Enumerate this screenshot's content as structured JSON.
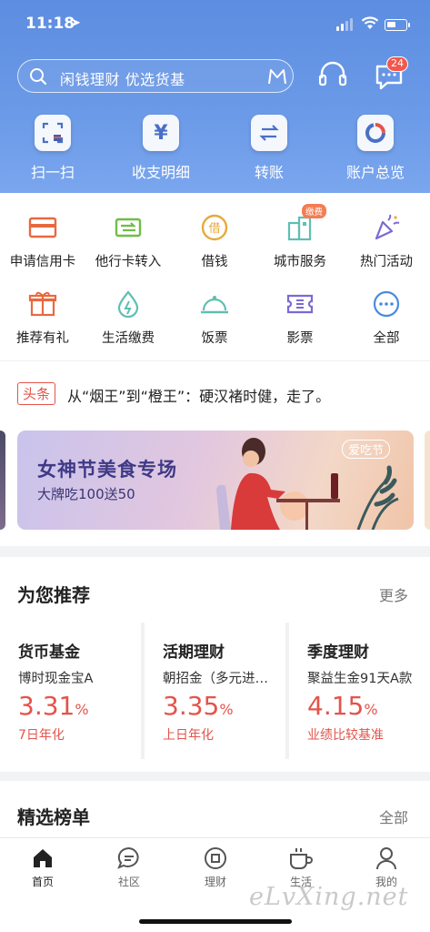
{
  "status_bar": {
    "time": "11:18"
  },
  "search": {
    "placeholder": "闲钱理财 优选货基"
  },
  "messages_badge": "24",
  "quick_actions": [
    {
      "label": "扫一扫",
      "icon": "scan-icon"
    },
    {
      "label": "收支明细",
      "icon": "yen-icon"
    },
    {
      "label": "转账",
      "icon": "transfer-icon"
    },
    {
      "label": "账户总览",
      "icon": "donut-chart-icon"
    }
  ],
  "services": [
    {
      "label": "申请信用卡",
      "icon": "credit-card-icon",
      "color": "#e8693f"
    },
    {
      "label": "他行卡转入",
      "icon": "card-transfer-icon",
      "color": "#6fbe44"
    },
    {
      "label": "借钱",
      "icon": "borrow-icon",
      "color": "#e8a93a",
      "glyph": "借"
    },
    {
      "label": "城市服务",
      "icon": "city-icon",
      "color": "#5fbfb2",
      "badge": "缴费"
    },
    {
      "label": "热门活动",
      "icon": "party-popper-icon",
      "color": "#7a6ad6"
    },
    {
      "label": "推荐有礼",
      "icon": "gift-icon",
      "color": "#e8693f"
    },
    {
      "label": "生活缴费",
      "icon": "water-drop-icon",
      "color": "#5fbfb2"
    },
    {
      "label": "饭票",
      "icon": "dish-cover-icon",
      "color": "#5fbfb2"
    },
    {
      "label": "影票",
      "icon": "ticket-icon",
      "color": "#7a6ad6"
    },
    {
      "label": "全部",
      "icon": "more-icon",
      "color": "#4a8be0"
    }
  ],
  "headline": {
    "tag": "头条",
    "text": "从“烟王”到“橙王”：硬汉褚时健，走了。"
  },
  "banner": {
    "title": "女神节美食专场",
    "subtitle": "大牌吃100送50",
    "tag": "爱吃节"
  },
  "recommend": {
    "title": "为您推荐",
    "more": "更多",
    "cards": [
      {
        "name": "货币基金",
        "product": "博时现金宝A",
        "rate": "3.31",
        "unit": "%",
        "desc": "7日年化"
      },
      {
        "name": "活期理财",
        "product": "朝招金（多元进…",
        "rate": "3.35",
        "unit": "%",
        "desc": "上日年化"
      },
      {
        "name": "季度理财",
        "product": "聚益生金91天A款",
        "rate": "4.15",
        "unit": "%",
        "desc": "业绩比较基准"
      }
    ]
  },
  "rankings": {
    "title": "精选榜单",
    "more": "全部"
  },
  "tabs": [
    {
      "label": "首页",
      "icon": "home-icon",
      "active": true
    },
    {
      "label": "社区",
      "icon": "chat-bubble-icon"
    },
    {
      "label": "理财",
      "icon": "finance-icon"
    },
    {
      "label": "生活",
      "icon": "coffee-cup-icon"
    },
    {
      "label": "我的",
      "icon": "user-icon"
    }
  ],
  "watermark": "eLvXing.net",
  "colors": {
    "header_blue": "#6b9ae8",
    "accent_red": "#e3544b"
  }
}
